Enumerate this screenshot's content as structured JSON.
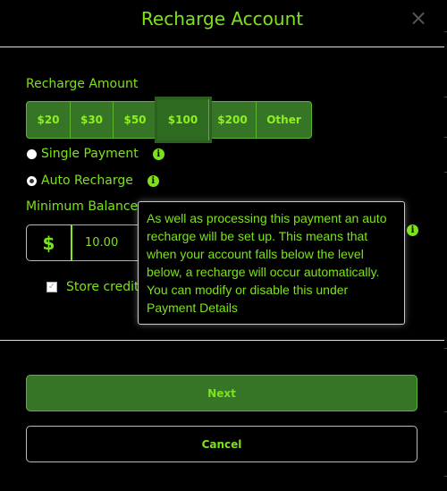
{
  "header": {
    "title": "Recharge Account",
    "close_icon": "×"
  },
  "recharge_amount": {
    "label": "Recharge Amount",
    "options": [
      "$20",
      "$30",
      "$50",
      "$100",
      "$200",
      "Other"
    ],
    "selected": "$100"
  },
  "payment_type": {
    "options": [
      {
        "label": "Single Payment",
        "checked": false,
        "info_icon": "i"
      },
      {
        "label": "Auto Recharge",
        "checked": true,
        "info_icon": "i"
      }
    ]
  },
  "minimum_balance": {
    "label": "Minimum Balance",
    "currency_symbol": "$",
    "value": "10.00",
    "info_icon": "i"
  },
  "store_card": {
    "label": "Store credit c",
    "checked": true,
    "check_glyph": "✓"
  },
  "tooltip": {
    "text": "As well as processing this payment an auto recharge will be set up. This means that when your account falls below the level below, a recharge will occur automatically. You can modify or disable this under Payment Details"
  },
  "buttons": {
    "next": "Next",
    "cancel": "Cancel"
  },
  "colors": {
    "accent": "#7de319",
    "button_green": "#357525",
    "background": "#000000"
  }
}
